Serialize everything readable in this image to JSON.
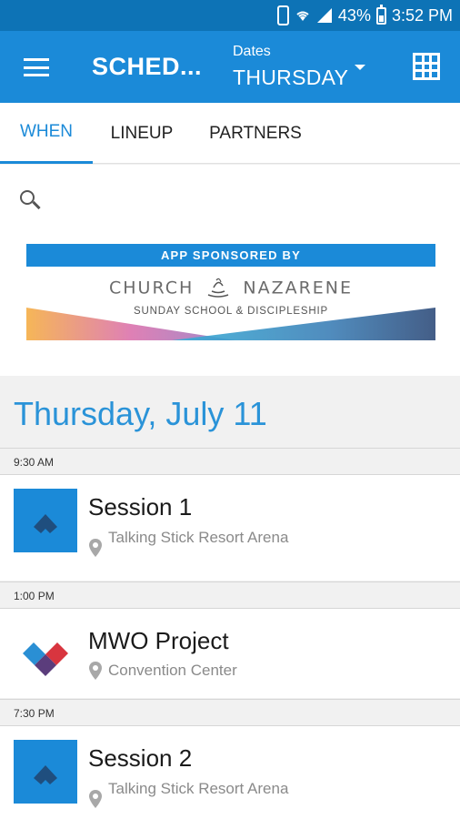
{
  "status_bar": {
    "battery": "43%",
    "time": "3:52 PM",
    "icons": [
      "phone-icon",
      "wifi-icon",
      "signal-icon",
      "battery-icon"
    ]
  },
  "app_bar": {
    "title": "SCHED...",
    "dates_label": "Dates",
    "dates_value": "THURSDAY",
    "icons": [
      "menu-icon",
      "dropdown-icon",
      "grid-icon"
    ]
  },
  "tabs": [
    {
      "label": "WHEN",
      "active": true
    },
    {
      "label": "LINEUP",
      "active": false
    },
    {
      "label": "PARTNERS",
      "active": false
    }
  ],
  "sponsor": {
    "banner": "APP SPONSORED BY",
    "left_word": "CHURCH",
    "right_word": "NAZARENE",
    "tagline": "SUNDAY SCHOOL & DISCIPLESHIP"
  },
  "schedule": {
    "day": "Thursday, July 11",
    "events": [
      {
        "time": "9:30 AM",
        "title": "Session 1",
        "location": "Talking Stick Resort Arena"
      },
      {
        "time": "1:00 PM",
        "title": "MWO Project",
        "location": "Convention Center"
      },
      {
        "time": "7:30 PM",
        "title": "Session 2",
        "location": "Talking Stick Resort Arena"
      }
    ]
  },
  "colors": {
    "status_bar": "#0d73b6",
    "app_bar": "#1b8ad8",
    "accent": "#2a93d8",
    "text_secondary": "#8a8a8a"
  }
}
